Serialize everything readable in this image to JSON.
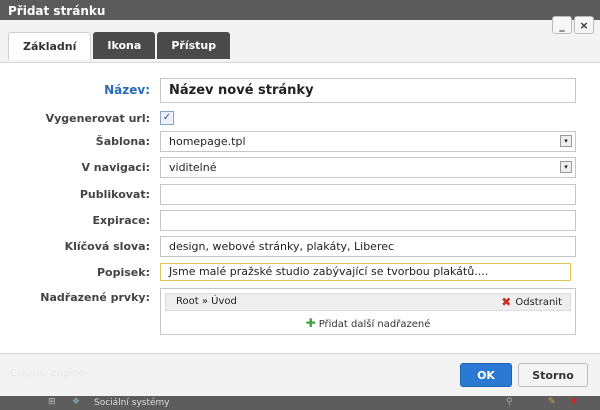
{
  "window": {
    "title": "Přidat stránku"
  },
  "dialog": {
    "minimize_label": "_",
    "close_label": "×"
  },
  "tabs": [
    {
      "label": "Základní",
      "active": true
    },
    {
      "label": "Ikona"
    },
    {
      "label": "Přístup"
    }
  ],
  "form": {
    "nazev": {
      "label": "Název:",
      "value": "Název nové stránky"
    },
    "vygenerovat_url": {
      "label": "Vygenerovat url:",
      "checked": true,
      "mark": "✓"
    },
    "sablona": {
      "label": "Šablona:",
      "value": "homepage.tpl",
      "arrow": "▾"
    },
    "v_navigaci": {
      "label": "V navigaci:",
      "value": "viditelné",
      "arrow": "▾"
    },
    "publikovat": {
      "label": "Publikovat:",
      "value": ""
    },
    "expirace": {
      "label": "Expirace:",
      "value": ""
    },
    "klicova_slova": {
      "label": "Klíčová slova:",
      "value": "design, webové stránky, plakáty, Liberec"
    },
    "popisek": {
      "label": "Popisek:",
      "value": "Jsme malé pražské studio zabývající se tvorbou plakátů...."
    },
    "nadrazene": {
      "label": "Nadřazené prvky:",
      "item": "Root » Úvod",
      "remove_label": "Odstranit",
      "add_label": "Přidat další nadřazené"
    }
  },
  "footer": {
    "engine_label": "CUQUO engine",
    "ok_label": "OK",
    "cancel_label": "Storno"
  },
  "background": {
    "row_text": "Sociální systémy"
  },
  "colors": {
    "accent": "#2a7ad3",
    "remove": "#cc2a1e",
    "add": "#3ea33a",
    "title_label": "#2a6bb5"
  }
}
